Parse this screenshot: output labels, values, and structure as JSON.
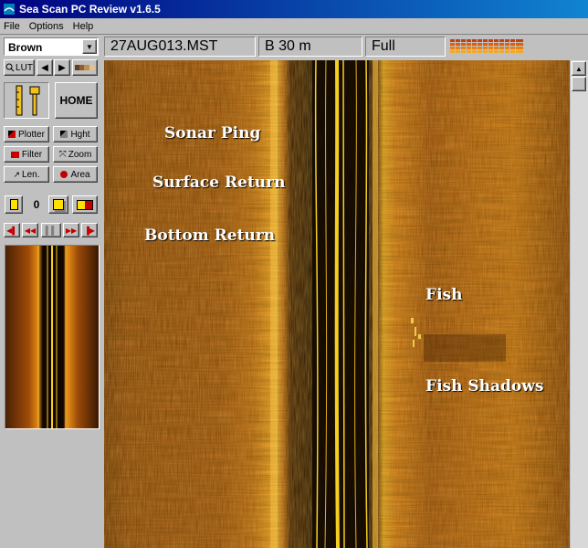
{
  "window": {
    "title": "Sea Scan PC Review v1.6.5"
  },
  "menu": [
    "File",
    "Options",
    "Help"
  ],
  "toolbar": {
    "palette_value": "Brown",
    "lut_label": "LUT",
    "home_label": "HOME",
    "counter_value": "0"
  },
  "tools": {
    "plotter": "Plotter",
    "height": "Hght",
    "filter": "Filter",
    "zoom": "Zoom",
    "length": "Len.",
    "area": "Area"
  },
  "header": {
    "filename": "27AUG013.MST",
    "range": "B 30 m",
    "mode": "Full"
  },
  "annotations": {
    "sonar_ping": "Sonar Ping",
    "surface_return": "Surface Return",
    "bottom_return": "Bottom Return",
    "fish": "Fish",
    "fish_shadows": "Fish Shadows"
  },
  "colors": {
    "sonar_dark": "#3a1a02",
    "sonar_mid": "#9a4a08",
    "sonar_bright": "#f0b020",
    "track_yellow": "#f5d020",
    "water_column": "#0d0500"
  }
}
